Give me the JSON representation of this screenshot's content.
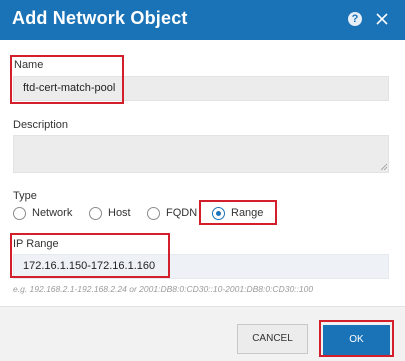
{
  "dialog": {
    "title": "Add Network Object",
    "help_glyph": "?",
    "icons": [
      "help-icon",
      "close-icon"
    ]
  },
  "name_field": {
    "label": "Name",
    "value": "ftd-cert-match-pool"
  },
  "description_field": {
    "label": "Description",
    "value": ""
  },
  "type": {
    "label": "Type",
    "options": [
      "Network",
      "Host",
      "FQDN",
      "Range"
    ],
    "selected": "Range"
  },
  "ip_range": {
    "label": "IP Range",
    "value": "172.16.1.150-172.16.1.160",
    "hint": "e.g. 192.168.2.1-192.168.2.24 or 2001:DB8:0:CD30::10-2001:DB8:0:CD30::100"
  },
  "footer": {
    "cancel_label": "CANCEL",
    "ok_label": "OK"
  },
  "colors": {
    "accent": "#1b73b7",
    "highlight": "#d21f2b"
  }
}
